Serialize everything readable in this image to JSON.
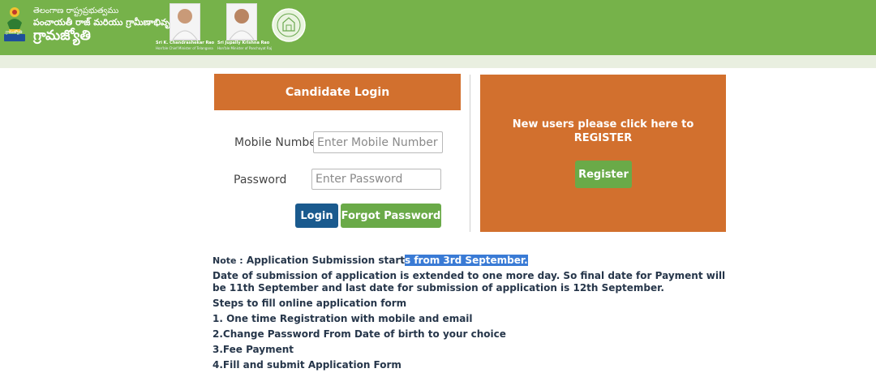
{
  "header": {
    "org_line1": "తెలంగాణ రాష్ట్రప్రభుత్వము",
    "org_line2": "పంచాయతీ రాజ్ మరియు గ్రామీణాభివృద్ధి శాఖ",
    "org_title": "గ్రామజ్యోతి",
    "emblem_caption": "గ్రామజ్యోతి",
    "person1_name": "Sri K. Chandrashekar Rao",
    "person1_title": "Hon'ble Chief Minister of Telangana",
    "person2_name": "Sri Jupally Krishna Rao",
    "person2_title": "Hon'ble Minister of Panchayat Raj"
  },
  "login": {
    "title": "Candidate Login",
    "mobile_label": "Mobile Number",
    "mobile_placeholder": "Enter Mobile Number",
    "password_label": "Password",
    "password_placeholder": "Enter Password",
    "login_button": "Login",
    "forgot_button": "Forgot Password"
  },
  "register": {
    "prompt_line1": "New users please click here to",
    "prompt_line2": "REGISTER",
    "button": "Register"
  },
  "notes": {
    "label": "Note :",
    "line1_plain": "Application Submission start",
    "line1_selected": "s from 3rd September.",
    "line2": "Date of submission of application is extended to one more day. So final date for Payment will be 11th September and last date for submission of application is 12th September.",
    "steps_title": "Steps to fill online application form",
    "step1": "1. One time Registration with mobile and email",
    "step2": "2.Change Password From Date of birth to your choice",
    "step3": "3.Fee Payment",
    "step4": "4.Fill and submit Application Form"
  },
  "colors": {
    "header_green": "#76b24a",
    "accent_orange": "#d2702e",
    "login_blue": "#1a5a8e",
    "button_green": "#6aaa48",
    "text_dark": "#26364a",
    "selection": "#3a7bd5"
  }
}
